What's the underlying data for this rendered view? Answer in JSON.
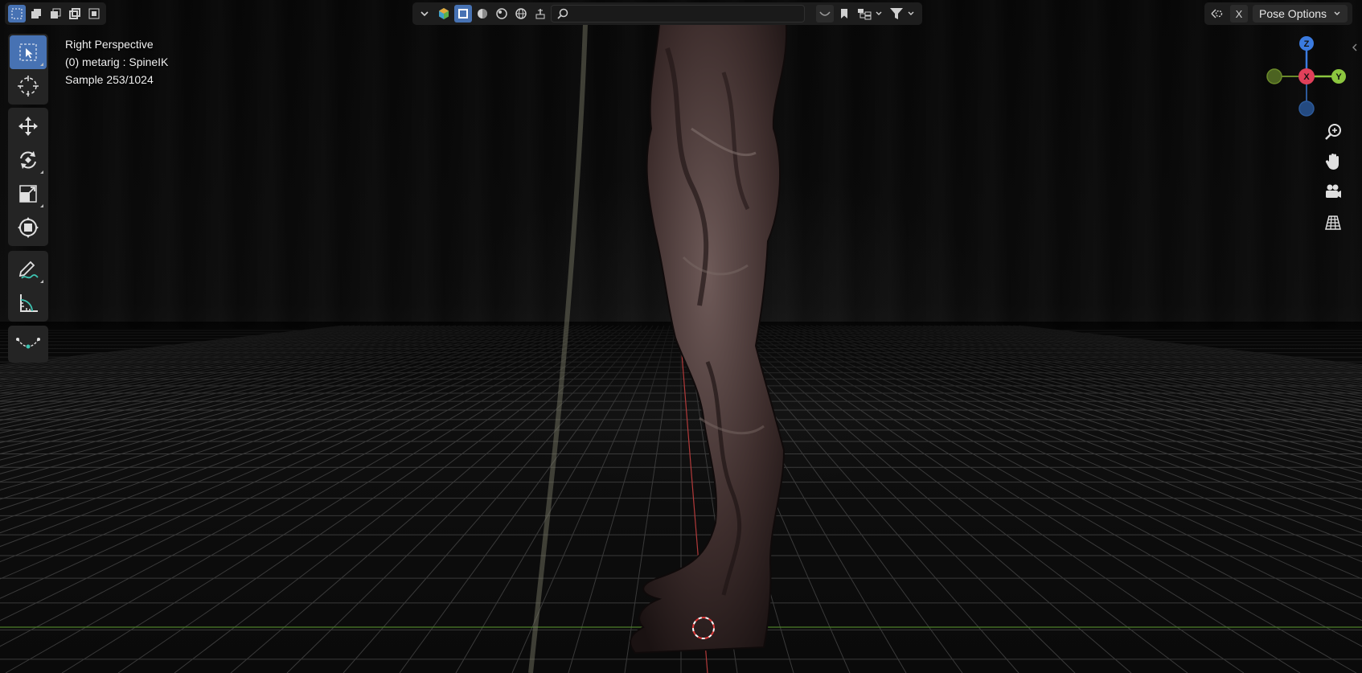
{
  "viewport": {
    "view_name": "Right Perspective",
    "object_info": "(0) metarig : SpineIK",
    "render_sample": "Sample 253/1024"
  },
  "header": {
    "pose_options_label": "Pose Options",
    "x_label": "X",
    "accent_color": "#4772b3"
  },
  "gizmo": {
    "z_label": "Z",
    "x_label": "X",
    "y_label": "Y",
    "colors": {
      "x": "#e0405a",
      "y": "#8cc63f",
      "z": "#3b7be0",
      "neg_y": "#6b8a2a",
      "neg_z": "#2d5a9a"
    }
  },
  "icons": {
    "toolbar": [
      "select-box-icon",
      "cursor-icon",
      "move-icon",
      "rotate-icon",
      "scale-icon",
      "transform-icon",
      "annotate-icon",
      "measure-icon",
      "bone-envelope-icon"
    ],
    "navigation": [
      "zoom-icon",
      "pan-hand-icon",
      "camera-icon",
      "grid-view-icon"
    ]
  }
}
